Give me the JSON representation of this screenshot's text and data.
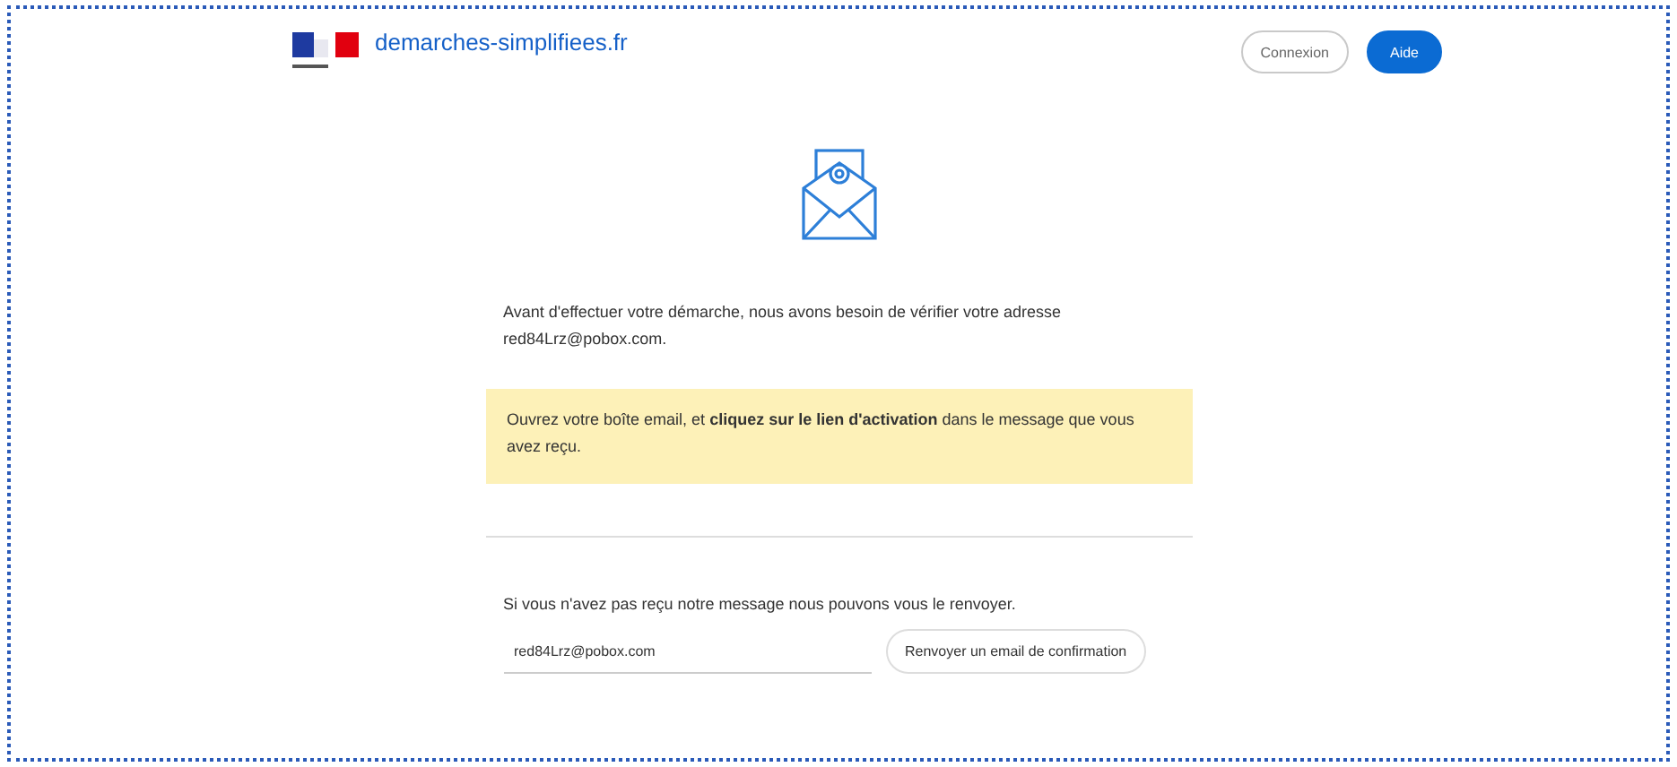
{
  "header": {
    "site_name": "demarches-simplifiees.fr",
    "buttons": [
      {
        "label": "Connexion",
        "kind": "outline"
      },
      {
        "label": "Aide",
        "kind": "primary"
      }
    ]
  },
  "intro": "Avant d'effectuer votre démarche, nous avons besoin de vérifier votre adresse red84Lrz@pobox.com.",
  "notice": "Ouvrez votre boîte email, et **cliquez sur le lien d'activation** dans le message que vous avez reçu.",
  "resend": {
    "text": "Si vous n'avez pas reçu notre message nous pouvons vous le renvoyer.",
    "email": "red84Lrz@pobox.com",
    "button": "Renvoyer un email de confirmation"
  }
}
